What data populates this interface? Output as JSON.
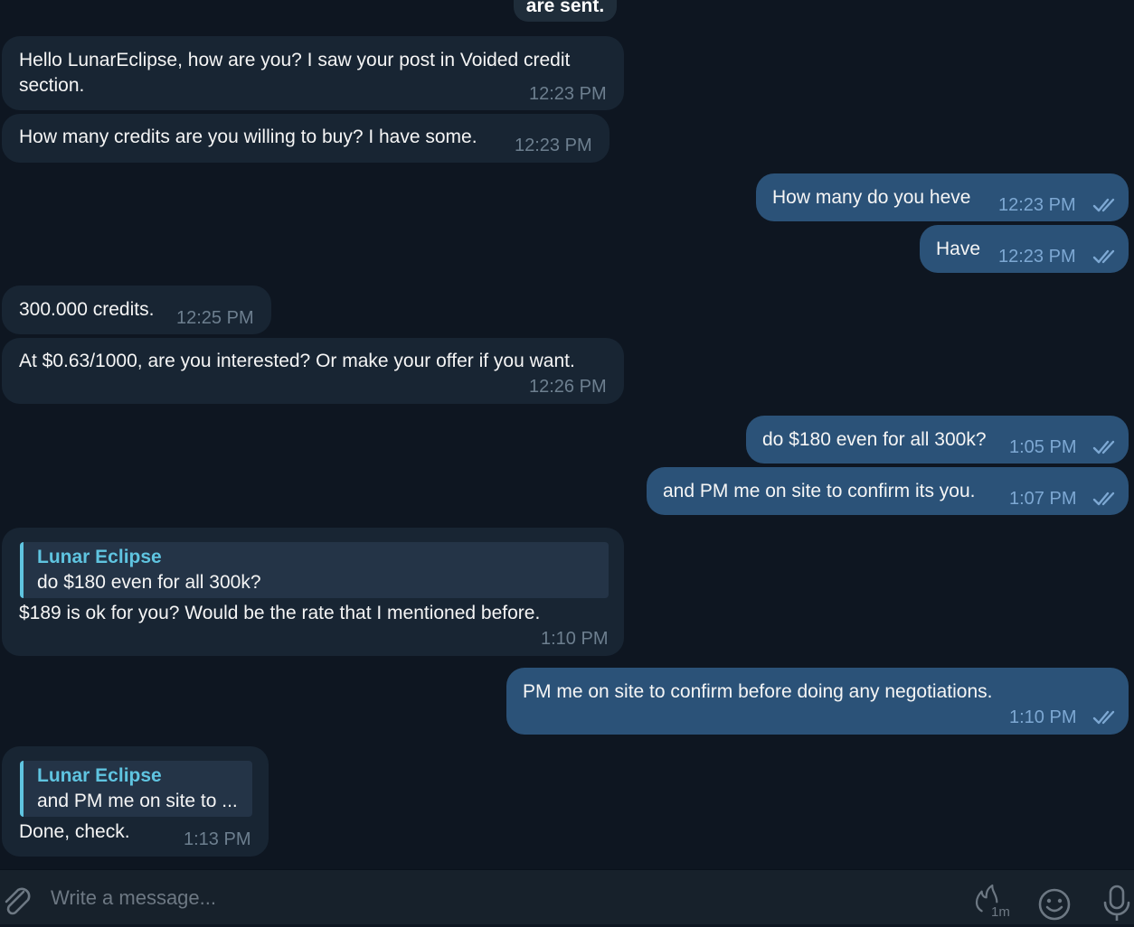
{
  "system_note": "are sent.",
  "messages": [
    {
      "text": "Hello LunarEclipse, how are you? I saw your post in Voided credit",
      "text2": "section.",
      "time": "12:23 PM"
    },
    {
      "text": "How many credits are you willing to buy? I have some.",
      "time": "12:23 PM"
    },
    {
      "text": "How many do you heve",
      "time": "12:23 PM"
    },
    {
      "text": "Have",
      "time": "12:23 PM"
    },
    {
      "text": "300.000 credits.",
      "time": "12:25 PM"
    },
    {
      "text": "At $0.63/1000, are you interested? Or make your offer if you want.",
      "time": "12:26 PM"
    },
    {
      "text": "do $180 even for all 300k?",
      "time": "1:05 PM"
    },
    {
      "text": "and PM me on site to confirm its you.",
      "time": "1:07 PM"
    },
    {
      "reply_name": "Lunar Eclipse",
      "reply_text": "do $180 even for all 300k?",
      "text": "$189 is ok for you? Would be the rate that I mentioned before.",
      "time": "1:10 PM"
    },
    {
      "text": "PM me on site to confirm before doing any negotiations.",
      "time": "1:10 PM"
    },
    {
      "reply_name": "Lunar Eclipse",
      "reply_text": "and PM me on site to ...",
      "text": "Done, check.",
      "time": "1:13 PM"
    }
  ],
  "composer": {
    "placeholder": "Write a message...",
    "timer_label": "1m"
  },
  "colors": {
    "background": "#0e1621",
    "incoming_bubble": "#182533",
    "outgoing_bubble": "#2b5278",
    "accent": "#5fc4e0"
  }
}
